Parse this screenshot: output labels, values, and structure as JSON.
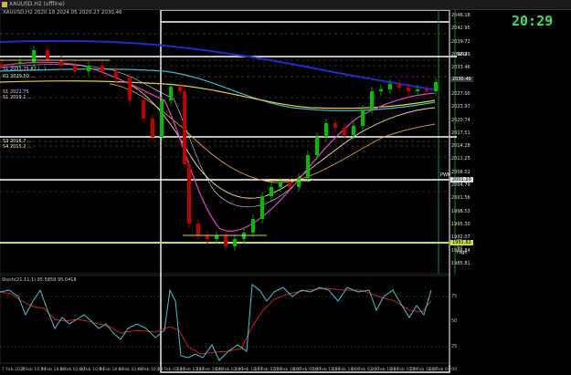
{
  "window": {
    "title": "XAUUSD,H2 (offline)",
    "ohlc_header": "XAUUSD,H2  2020.18 2024.05 2020.27 2030.46"
  },
  "clock": "20:29",
  "colors": {
    "background": "#000000",
    "bull": "#00c000",
    "bear": "#c00000",
    "ema_blue": "#1a2fcc",
    "ema_cyan": "#35c0c8",
    "ema_yellow": "#e8d040",
    "ema_magenta": "#e040c0",
    "level_white": "#ffffff",
    "level_yellowgreen": "#c8e030",
    "stoch_main": "#40c8d8",
    "stoch_signal": "#d02020",
    "clock": "#3be06b"
  },
  "right_axis": {
    "prices": [
      "2046.18",
      "2042.95",
      "2039.72",
      "2036.49",
      "2033.46",
      "2030.23",
      "2027.00",
      "2023.97",
      "2020.74",
      "2017.51",
      "2014.28",
      "2011.25",
      "2008.02",
      "2004.79",
      "2001.56",
      "1998.53",
      "1995.30",
      "1992.07",
      "1988.84",
      "1985.81"
    ]
  },
  "price_badges": [
    {
      "text": "2030.46",
      "bg": "#333333",
      "fg": "#ffffff"
    },
    {
      "text": "2001.20",
      "bg": "#dddddd",
      "fg": "#000000"
    },
    {
      "text": "1991.82",
      "bg": "#c8e030",
      "fg": "#000000"
    }
  ],
  "level_labels": {
    "r2": "WR2",
    "s2": "S2 (...)",
    "pivot": "PWP",
    "s5": "S5",
    "s7": "S7",
    "high": "High"
  },
  "left_labels": [
    "S1 2031.75 R2 (...)",
    "R1 2029.50 ...",
    "S1 2022.75",
    "S1 2019.1 ...",
    "S3 2016.7 ...",
    "S4 2015.2 ..."
  ],
  "x_axis": [
    "7 Feb 2024",
    "7 Feb 10:00",
    "7 Feb 18:00",
    "8 Feb 02:00",
    "8 Feb 10:00",
    "8 Feb 18:00",
    "9 Feb 02:00",
    "9 Feb 10:00",
    "12 Feb 02:00",
    "12 Feb 10:00",
    "13 Feb 10:00",
    "14 Feb 02:00",
    "14 Feb 18:00",
    "15 Feb 02:00",
    "15 Feb 18:00",
    "16 Feb 02:00",
    "16 Feb 18:00",
    "19 Feb 18:00",
    "20 Feb 02:00",
    "20 Feb 18:00",
    "21 Feb 10:00",
    "21 Feb 18:00",
    "22 Feb 04:00"
  ],
  "stochastic": {
    "label": "Stoch(21,11,1) 95.5859 95.0418",
    "scale": [
      "100",
      "75",
      "50",
      "25",
      "0"
    ]
  }
}
